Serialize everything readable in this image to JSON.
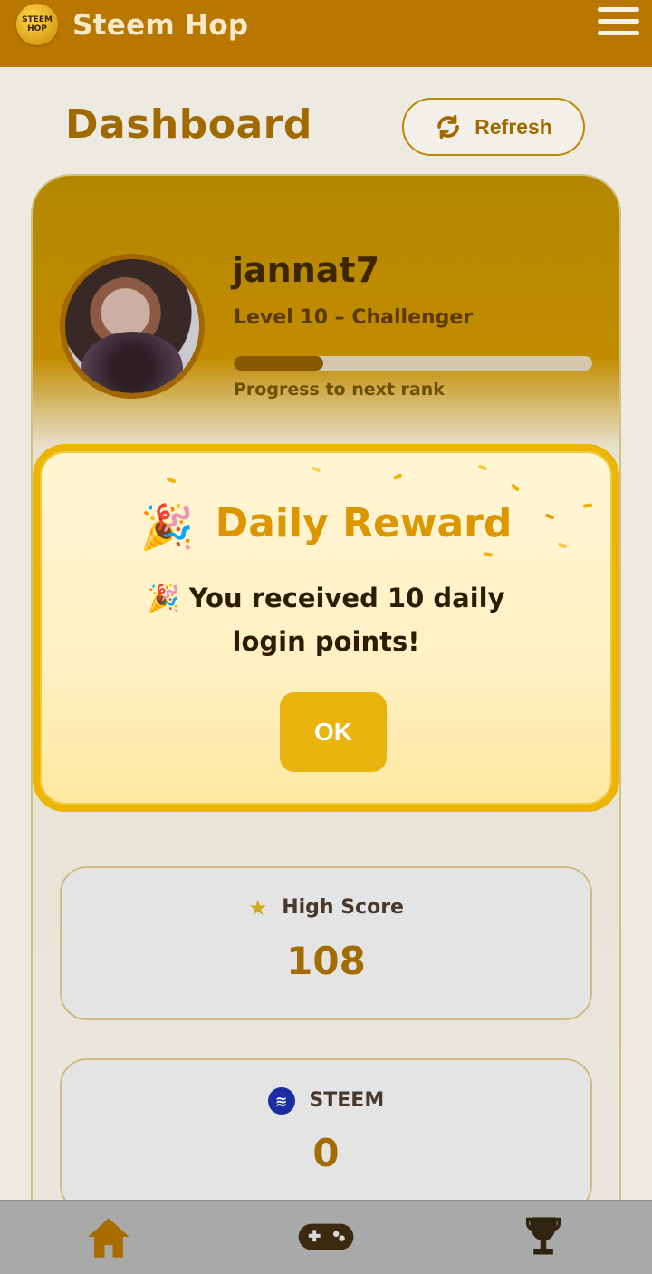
{
  "app": {
    "name": "Steem Hop",
    "logo_text": "STEEM HOP"
  },
  "header": {
    "menu_icon": "hamburger-icon"
  },
  "page": {
    "title": "Dashboard",
    "refresh_label": "Refresh",
    "refresh_icon": "refresh-icon"
  },
  "profile": {
    "username": "jannat7",
    "level_text": "Level 10 – Challenger",
    "progress_fraction": 0.25,
    "progress_label": "Progress to next rank"
  },
  "stats": [
    {
      "label": "High Score",
      "value": "108",
      "icon": "star-icon"
    },
    {
      "label": "STEEM",
      "value": "0",
      "icon": "steem-icon"
    }
  ],
  "modal": {
    "title": "Daily Reward",
    "message": "You received 10 daily login points!",
    "ok_label": "OK"
  },
  "nav": {
    "items": [
      "home-icon",
      "gamepad-icon",
      "trophy-icon"
    ]
  },
  "colors": {
    "header": "#b87700",
    "accent": "#a56d00",
    "modal_border": "#ebb500",
    "ok_button": "#e9b30d"
  }
}
